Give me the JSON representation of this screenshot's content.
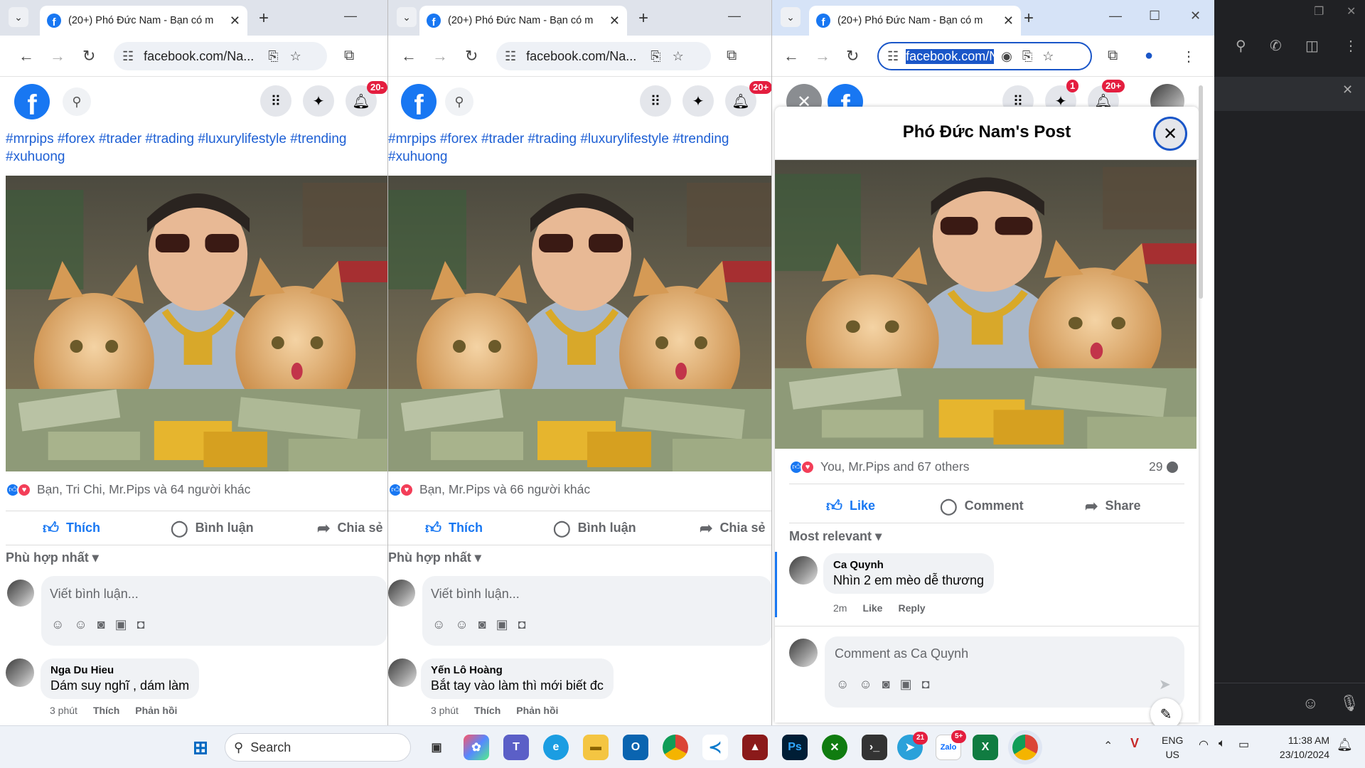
{
  "browser": {
    "tab_title": "(20+) Phó Đức Nam - Bạn có m",
    "url": "facebook.com/Na...",
    "url_selected": "facebook.com/N"
  },
  "facebook": {
    "notif_badge": "20+",
    "notif_badge_cut": "20-",
    "messenger_badge": "1",
    "hashtags": "#mrpips #forex #trader #trading #luxurylifestyle #trending #xuhuong"
  },
  "left": {
    "reactions": "Bạn, Tri Chi, Mr.Pips và 64 người khác",
    "like": "Thích",
    "comment": "Bình luận",
    "share": "Chia sẻ",
    "sort": "Phù hợp nhất",
    "placeholder": "Viết bình luận...",
    "comment_name": "Nga Du Hieu",
    "comment_text": "Dám suy nghĩ , dám làm",
    "time": "3 phút",
    "like_link": "Thích",
    "reply_link": "Phản hồi"
  },
  "middle": {
    "reactions": "Bạn, Mr.Pips và 66 người khác",
    "like": "Thích",
    "comment": "Bình luận",
    "share": "Chia sẻ",
    "sort": "Phù hợp nhất",
    "placeholder": "Viết bình luận...",
    "comment_name": "Yến Lô Hoàng",
    "comment_text": "Bắt tay vào làm thì mới biết đc",
    "time": "3 phút",
    "like_link": "Thích",
    "reply_link": "Phản hồi"
  },
  "right": {
    "post_title": "Phó Đức Nam's Post",
    "reactions": "You, Mr.Pips and 67 others",
    "comment_count": "29",
    "like": "Like",
    "comment": "Comment",
    "share": "Share",
    "sort": "Most relevant",
    "comment_name": "Ca Quynh",
    "comment_text": "Nhìn 2 em mèo dễ thương",
    "time": "2m",
    "like_link": "Like",
    "reply_link": "Reply",
    "placeholder": "Comment as Ca Quynh"
  },
  "taskbar": {
    "search": "Search",
    "lang1": "ENG",
    "lang2": "US",
    "time": "11:38 AM",
    "date": "23/10/2024",
    "zalo_badge": "5+",
    "telegram_badge": "21"
  },
  "icons": {
    "messenger": "messenger-icon",
    "notifications": "bell-icon",
    "menu": "grid-menu-icon"
  },
  "colors": {
    "facebook_blue": "#1877f2",
    "hashtag": "#1d5fd4",
    "badge_red": "#e41e3f"
  }
}
